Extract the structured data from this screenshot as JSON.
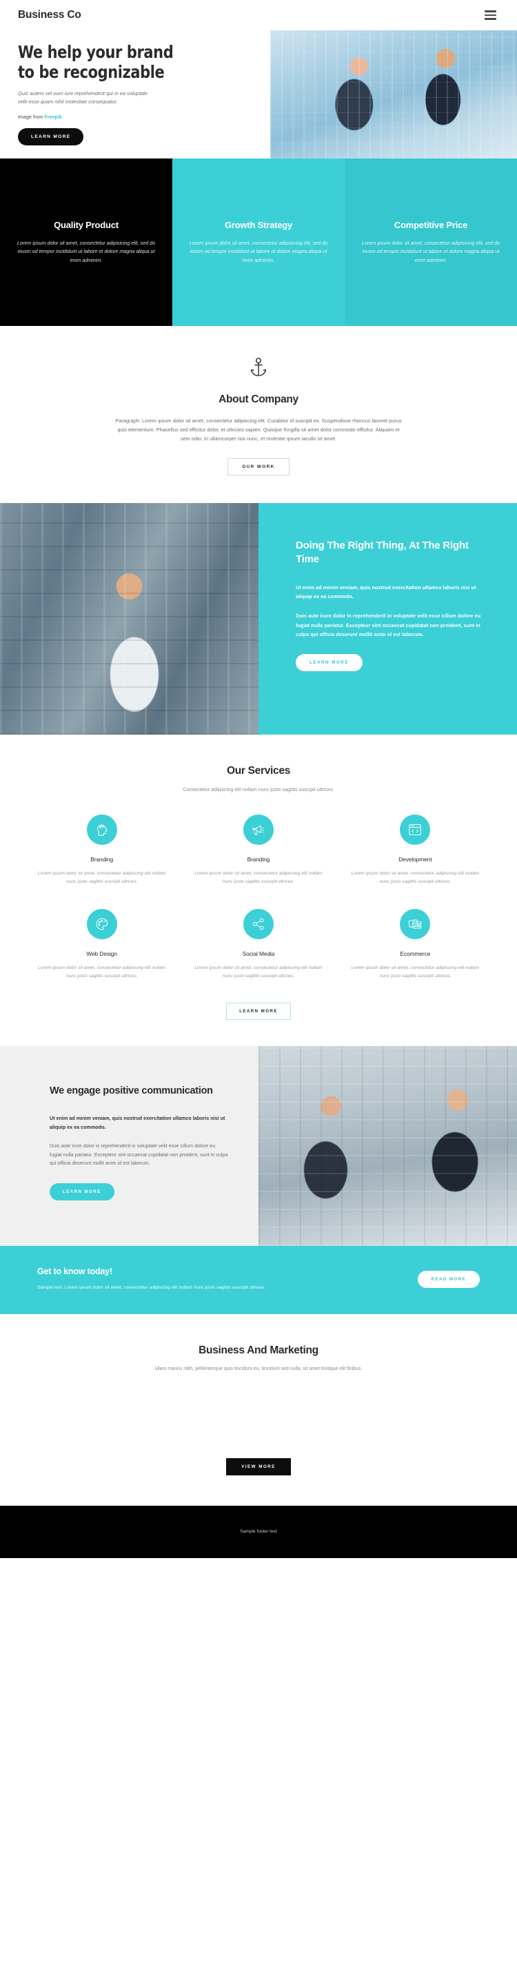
{
  "header": {
    "brand": "Business Co",
    "menu_icon": "hamburger-menu-icon"
  },
  "hero": {
    "title": "We help your brand to be recognizable",
    "subtitle": "Quis autem vel eum iure reprehenderit qui in ea voluptate velit esse quam nihil molestiae consequatur.",
    "credit_prefix": "Image from ",
    "credit_link": "Freepik",
    "cta": "LEARN MORE"
  },
  "feature_cards": [
    {
      "title": "Quality Product",
      "text": "Lorem ipsum dolor sit amet, consectetur adipisicing elit, sed do eiusm od tempor incididunt ut labore et dolore magna aliqua ut enim adminim."
    },
    {
      "title": "Growth Strategy",
      "text": "Lorem ipsum dolor sit amet, consectetur adipisicing elit, sed do eiusm od tempor incididunt ut labore et dolore magna aliqua ut enim adminim."
    },
    {
      "title": "Competitive Price",
      "text": "Lorem ipsum dolor sit amet, consectetur adipisicing elit, sed do eiusm od tempor incididunt ut labore et dolore magna aliqua ut enim adminim."
    }
  ],
  "about": {
    "icon": "anchor-icon",
    "title": "About Company",
    "paragraph": "Paragraph. Lorem ipsum dolor sit amet, consectetur adipiscing elit. Curabitur id suscipit ex. Suspendisse rhoncus laoreet purus quis elementum. Phasellus sed efficitur dolor, et ultricies sapien. Quisque fringilla sit amet dolor commodo efficitur. Aliquam et sem odio. In ullamcorper nisi nunc, et molestie ipsum iaculis sit amet.",
    "cta": "OUR WORK"
  },
  "split": {
    "title": "Doing The Right Thing, At The Right Time",
    "lead": "Ut enim ad minim veniam, quis nostrud exercitation ullamco laboris nisi ut aliquip ex ea commodo.",
    "body": "Duis aute irure dolor in reprehenderit in voluptate velit esse cillum dolore eu fugiat nulla pariatur. Excepteur sint occaecat cupidatat non proident, sunt in culpa qui officia deserunt mollit anim id est laborum.",
    "cta": "LEARN MORE"
  },
  "services": {
    "title": "Our Services",
    "subtitle": "Consectetur adipiscing elit nullam nunc justo sagittis suscipit ultrices.",
    "cta": "LEARN MORE",
    "items": [
      {
        "icon": "head-gears-icon",
        "title": "Branding",
        "text": "Lorem ipsum dolor sit amet, consectetur adipiscing elit nullam nunc justo sagittis suscipit ultrices."
      },
      {
        "icon": "megaphone-icon",
        "title": "Branding",
        "text": "Lorem ipsum dolor sit amet, consectetur adipiscing elit nullam nunc justo sagittis suscipit ultrices."
      },
      {
        "icon": "code-window-icon",
        "title": "Development",
        "text": "Lorem ipsum dolor sit amet, consectetur adipiscing elit nullam nunc justo sagittis suscipit ultrices."
      },
      {
        "icon": "palette-icon",
        "title": "Web Design",
        "text": "Lorem ipsum dolor sit amet, consectetur adipiscing elit nullam nunc justo sagittis suscipit ultrices."
      },
      {
        "icon": "share-nodes-icon",
        "title": "Social Media",
        "text": "Lorem ipsum dolor sit amet, consectetur adipiscing elit nullam nunc justo sagittis suscipit ultrices."
      },
      {
        "icon": "cards-icon",
        "title": "Ecommerce",
        "text": "Lorem ipsum dolor sit amet, consectetur adipiscing elit nullam nunc justo sagittis suscipit ultrices."
      }
    ]
  },
  "engage": {
    "title": "We engage positive communication",
    "lead": "Ut enim ad minim veniam, quis nostrud exercitation ullamco laboris nisi ut aliquip ex ea commodo.",
    "body": "Duis aute irure dolor in reprehenderit in voluptate velit esse cillum dolore eu fugiat nulla pariatur. Excepteur sint occaecat cupidatat non proident, sunt in culpa qui officia deserunt mollit anim id est laborum.",
    "cta": "LEARN MORE"
  },
  "cta_band": {
    "title": "Get to know today!",
    "text": "Sample text. Lorem ipsum dolor sit amet, consectetur adipiscing elit nullam nunc justo sagittis suscipit ultrices.",
    "cta": "READ MORE"
  },
  "business_marketing": {
    "title": "Business And Marketing",
    "subtitle": "ullam mauris nibh, pellentesque quis tincidunt eu, tincidunt sed nulla, sit amet tristique elit finibus.",
    "cta": "VIEW MORE"
  },
  "footer": {
    "text": "Sample footer text"
  },
  "colors": {
    "teal": "#3ccfd6",
    "dark": "#0d0d0d",
    "muted": "#8a8a8a",
    "light_gray": "#f0f0f0"
  }
}
